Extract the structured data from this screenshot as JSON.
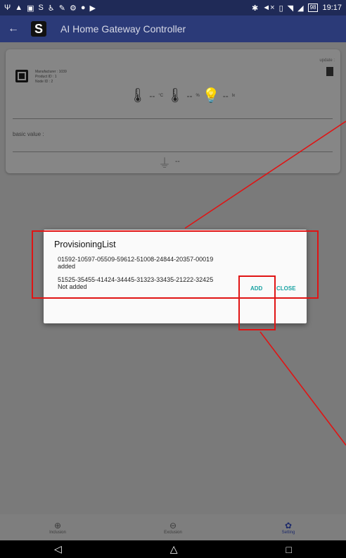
{
  "statusbar": {
    "time": "19:17",
    "battery": "98"
  },
  "appbar": {
    "logo": "S",
    "title": "AI Home Gateway Controller"
  },
  "card": {
    "manufacturer": "Manufacturer : 1039",
    "product": "Product ID : 1",
    "node": "Node ID : 2",
    "update_label": "update :",
    "temp_value": "--",
    "temp_unit": "°C",
    "humidity_value": "--",
    "humidity_unit": "%",
    "lux_value": "--",
    "lux_unit": "lx",
    "basic_label": "basic value :",
    "plug_value": "--"
  },
  "dialog": {
    "title": "ProvisioningList",
    "entries": [
      {
        "dsk": "01592-10597-05509-59612-51008-24844-20357-00019",
        "status": "added"
      },
      {
        "dsk": "51525-35455-41424-34445-31323-33435-21222-32425",
        "status": "Not added"
      }
    ],
    "add_label": "ADD",
    "close_label": "CLOSE"
  },
  "bottomnav": {
    "items": [
      {
        "label": "Inclusion",
        "icon": "plus-circle-icon"
      },
      {
        "label": "Exclusion",
        "icon": "minus-circle-icon"
      },
      {
        "label": "Setting",
        "icon": "gear-icon"
      }
    ]
  },
  "colors": {
    "appbar": "#2b3a78",
    "accent": "#1aa3a3",
    "annotation": "#e01414"
  }
}
